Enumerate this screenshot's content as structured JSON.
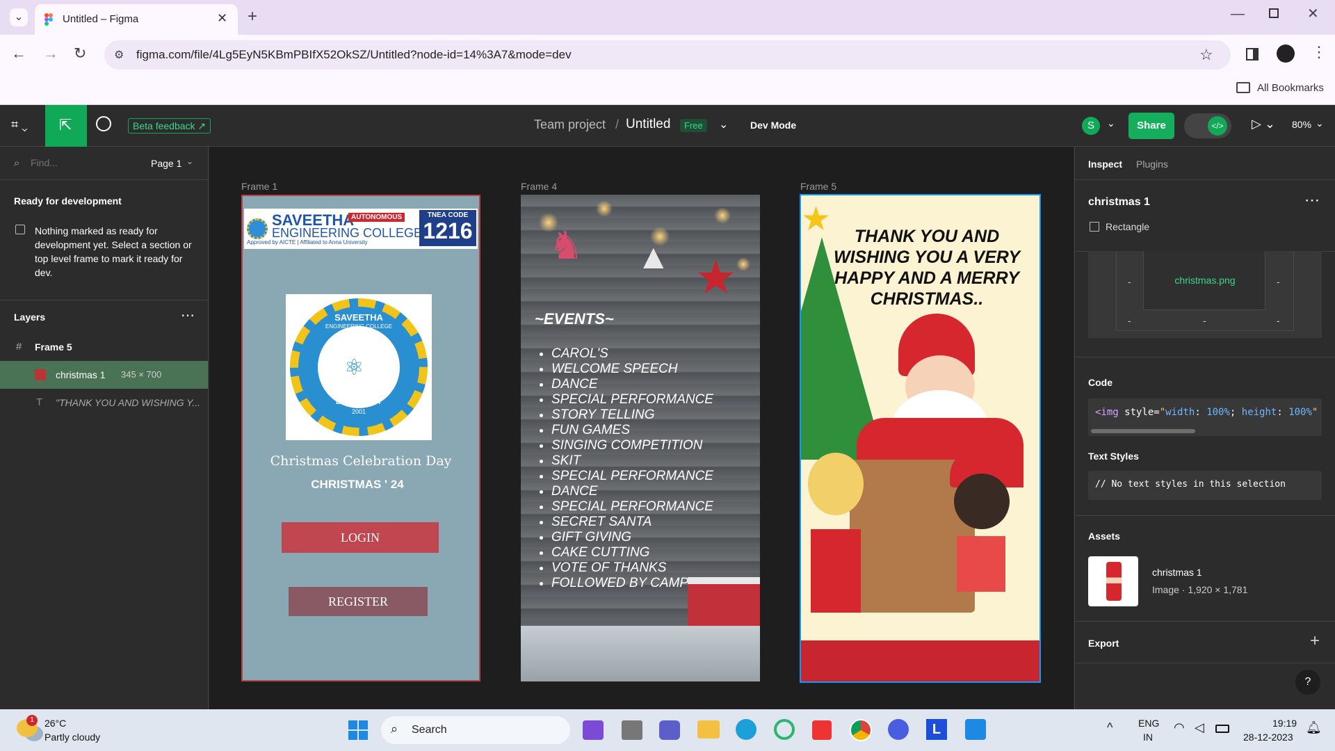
{
  "browser": {
    "tab_title": "Untitled – Figma",
    "url": "figma.com/file/4Lg5EyN5KBmPBIfX52OkSZ/Untitled?node-id=14%3A7&mode=dev",
    "bookmarks_label": "All Bookmarks"
  },
  "figma_header": {
    "beta_feedback": "Beta feedback",
    "project": "Team project",
    "separator": "/",
    "file_name": "Untitled",
    "plan_badge": "Free",
    "dev_mode": "Dev Mode",
    "avatar_letter": "S",
    "share": "Share",
    "zoom": "80%"
  },
  "left_panel": {
    "find_placeholder": "Find...",
    "page": "Page 1",
    "ready_title": "Ready for development",
    "ready_text": "Nothing marked as ready for development yet. Select a section or top level frame to mark it ready for dev.",
    "layers_title": "Layers",
    "layers": [
      {
        "name": "Frame 5"
      },
      {
        "name": "christmas 1",
        "dims": "345 × 700"
      },
      {
        "name": "\"THANK YOU AND WISHING Y..."
      }
    ]
  },
  "canvas": {
    "frame1": {
      "label": "Frame 1",
      "college_name_1": "SAVEETHA",
      "college_name_2": "ENGINEERING COLLEGE",
      "autonomous": "AUTONOMOUS",
      "tnea_label": "TNEA CODE",
      "tnea_code": "1216",
      "approved": "Approved by AICTE  |  Affiliated to Anna University",
      "emblem_top": "SAVEETHA",
      "emblem_sub": "ENGINEERING COLLEGE",
      "emblem_motto": "BE THE BEST",
      "emblem_year": "2001",
      "title": "Christmas Celebration Day",
      "subtitle": "CHRISTMAS ' 24",
      "login": "LOGIN",
      "register": "REGISTER"
    },
    "frame4": {
      "label": "Frame 4",
      "heading": "~EVENTS~",
      "events": [
        "CAROL'S",
        "WELCOME SPEECH",
        "DANCE",
        "SPECIAL PERFORMANCE",
        "STORY TELLING",
        "FUN GAMES",
        "SINGING COMPETITION",
        "SKIT",
        "SPECIAL PERFORMANCE",
        "DANCE",
        "SPECIAL PERFORMANCE",
        "SECRET SANTA",
        "GIFT GIVING",
        "CAKE CUTTING",
        "VOTE OF THANKS",
        "FOLLOWED BY CAMPFIRE"
      ]
    },
    "frame5": {
      "label": "Frame 5",
      "message": "THANK YOU  AND WISHING YOU A VERY HAPPY AND A MERRY CHRISTMAS.."
    }
  },
  "right_panel": {
    "tab_inspect": "Inspect",
    "tab_plugins": "Plugins",
    "selection_name": "christmas 1",
    "selection_type": "Rectangle",
    "box_center": "christmas.png",
    "dash": "-",
    "code_title": "Code",
    "code_tag": "<img",
    "code_attr": " style=",
    "code_q1": "\"",
    "code_prop1": "width",
    "code_colon1": ": ",
    "code_val1": "100%",
    "code_semi": "; ",
    "code_prop2": "height",
    "code_colon2": ": ",
    "code_val2": "100%",
    "code_q2": "\"",
    "text_styles_title": "Text Styles",
    "text_styles_value": "// No text styles in this selection",
    "assets_title": "Assets",
    "asset_name": "christmas 1",
    "asset_meta": "Image · 1,920 × 1,781",
    "export_title": "Export",
    "help": "?"
  },
  "taskbar": {
    "weather_temp": "26°C",
    "weather_desc": "Partly cloudy",
    "weather_badge": "1",
    "search": "Search",
    "lang_1": "ENG",
    "lang_2": "IN",
    "time": "19:19",
    "date": "28-12-2023"
  },
  "colors": {
    "figma_green": "#0fa958",
    "share_green": "#14ae5c",
    "selection_blue": "#0d99ff",
    "frame1_bg": "#8aa7b4",
    "login_red": "#c0474f",
    "register_mauve": "#8a5a64"
  }
}
